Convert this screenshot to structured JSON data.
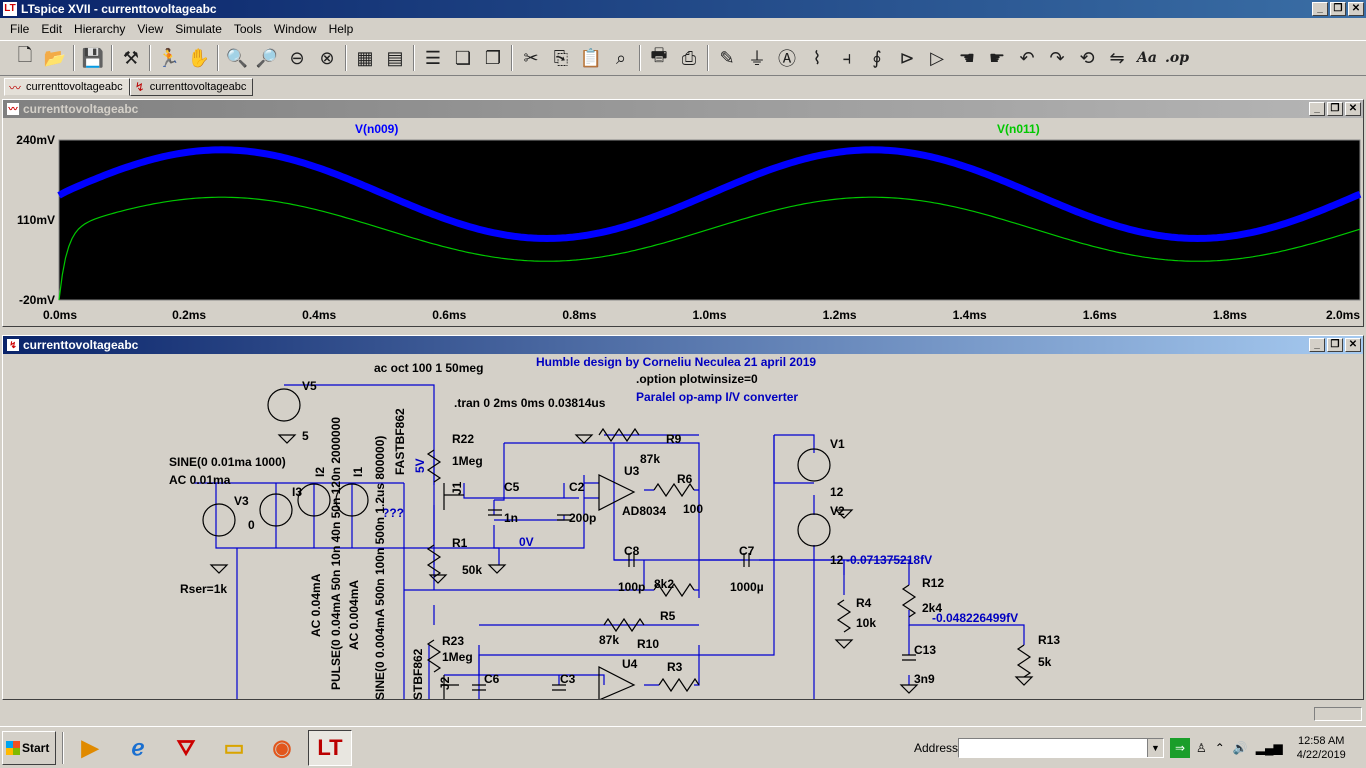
{
  "window": {
    "title": "LTspice XVII - currenttovoltageabc",
    "minimize": "_",
    "restore": "❐",
    "close": "✕"
  },
  "menu": [
    "File",
    "Edit",
    "Hierarchy",
    "View",
    "Simulate",
    "Tools",
    "Window",
    "Help"
  ],
  "toolbar_text": {
    "font": "Aa",
    "op": ".op"
  },
  "tabs": [
    {
      "label": "currenttovoltageabc",
      "icon": "waveform-icon"
    },
    {
      "label": "currenttovoltageabc",
      "icon": "schematic-icon"
    }
  ],
  "waveform_window": {
    "title": "currenttovoltageabc",
    "traces": [
      {
        "name": "V(n009)",
        "color": "#0000ff"
      },
      {
        "name": "V(n011)",
        "color": "#00c800"
      }
    ],
    "y_ticks": [
      "240mV",
      "110mV",
      "-20mV"
    ],
    "x_ticks": [
      "0.0ms",
      "0.2ms",
      "0.4ms",
      "0.6ms",
      "0.8ms",
      "1.0ms",
      "1.2ms",
      "1.4ms",
      "1.6ms",
      "1.8ms",
      "2.0ms"
    ]
  },
  "chart_data": {
    "type": "line",
    "x_unit": "ms",
    "y_unit": "mV",
    "xlim": [
      0.0,
      2.0
    ],
    "ylim": [
      -20,
      240
    ],
    "grid": false,
    "background": "#000000",
    "series": [
      {
        "name": "V(n009)",
        "color": "#0000ff",
        "offset_mV": 152,
        "amplitude_mV": 72,
        "frequency_hz": 1000,
        "start_mV": 150
      },
      {
        "name": "V(n011)",
        "color": "#00c800",
        "offset_mV": 95,
        "amplitude_mV": 52,
        "frequency_hz": 1000,
        "start_mV": -20
      }
    ]
  },
  "schematic_window": {
    "title": "currenttovoltageabc",
    "texts": {
      "ac_directive": "ac oct 100 1 50meg",
      "humble": "Humble design by Corneliu Neculea 21 april 2019",
      "option": ".option plotwinsize=0",
      "paralel": "Paralel op-amp I/V converter",
      "tran": ".tran 0 2ms 0ms 0.03814us",
      "v5": "V5",
      "v5_val": "5",
      "r22": "R22",
      "r22_val": "1Meg",
      "v5_net": "5V",
      "fastbf": "FASTBF862",
      "r9": "R9",
      "r9_val": "87k",
      "u3": "U3",
      "u3_model": "AD8034",
      "r6": "R6",
      "r6_val": "100",
      "v1": "V1",
      "v1_val": "12",
      "v2": "V2",
      "v2_val": "12",
      "sine": "SINE(0 0.01ma 1000)",
      "ac001": "AC 0.01ma",
      "v3": "V3",
      "v3_val": "0",
      "i3": "I3",
      "i2": "I2",
      "i1": "I1",
      "j1": "J1",
      "c5": "C5",
      "c5_val": "1n",
      "c2": "C2",
      "c2_val": "200p",
      "qqq": "???",
      "r1": "R1",
      "r1_val": "50k",
      "zero_v": "0V",
      "c8": "C8",
      "c8_val": "100p",
      "r5_val": "8k2",
      "r5": "R5",
      "c7": "C7",
      "c7_val": "1000µ",
      "meas1": "-0.071375218fV",
      "r12": "R12",
      "r12_val": "2k4",
      "r4": "R4",
      "r4_val": "10k",
      "meas2": "-0.048226499fV",
      "r13": "R13",
      "r13_val": "5k",
      "rser": "Rser=1k",
      "ac004": "AC 0.04mA",
      "pulse": "PULSE(0 0.04mA 50n 10n 40n 50n 120n 2000000",
      "ac0004": "AC 0.004mA",
      "sine2": "SINE(0 0.004mA 500n 100n 500n 1.2us 800000)",
      "r10_val": "87k",
      "r10": "R10",
      "r23": "R23",
      "r23_val": "1Meg",
      "fastbf2": "STBF862",
      "j2": "J2",
      "c6": "C6",
      "c3": "C3",
      "u4": "U4",
      "r3": "R3",
      "c13": "C13",
      "c13_val": "3n9"
    }
  },
  "taskbar": {
    "start": "Start",
    "address_label": "Address",
    "address_value": "",
    "clock_time": "12:58 AM",
    "clock_date": "4/22/2019",
    "colors": {
      "accent": "#0a246a",
      "trace1": "#0000ff",
      "trace2": "#00c800",
      "schematic_text": "#0000c0"
    }
  }
}
